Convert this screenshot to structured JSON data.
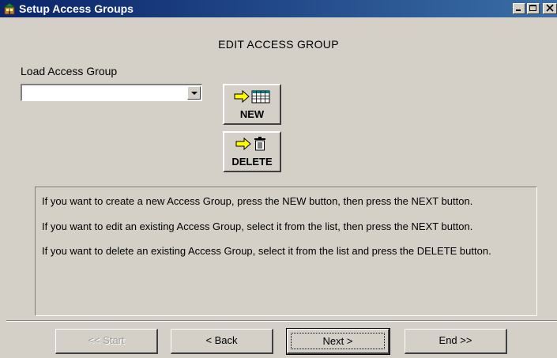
{
  "window": {
    "title": "Setup Access Groups",
    "controls": [
      "minimize",
      "maximize",
      "close"
    ]
  },
  "heading": "EDIT ACCESS GROUP",
  "load_group": {
    "label": "Load Access Group",
    "selected_value": ""
  },
  "buttons": {
    "new_label": "NEW",
    "delete_label": "DELETE"
  },
  "info": {
    "lines": [
      "If you want to create a new Access Group, press the NEW button, then press the NEXT button.",
      "If you want to edit an existing Access Group, select it from the list, then press the NEXT button.",
      "If you want to delete an existing Access Group, select it from the list and press the DELETE button."
    ]
  },
  "nav": {
    "start": "<< Start",
    "back": "< Back",
    "next": "Next >",
    "end": "End >>"
  },
  "icons": {
    "app": "building-icon",
    "new": [
      "arrow-right-icon",
      "grid-icon"
    ],
    "delete": [
      "arrow-right-icon",
      "trash-icon"
    ]
  },
  "colors": {
    "titlebar": "#0a246a",
    "face": "#d4d0c8",
    "arrow": "#ffff00"
  }
}
